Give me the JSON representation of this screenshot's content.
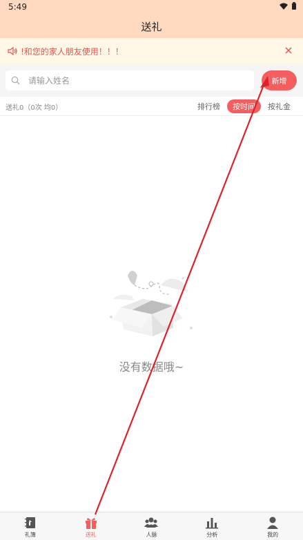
{
  "status_bar": {
    "time": "5:49"
  },
  "header": {
    "title": "送礼"
  },
  "notice": {
    "text": "!和您的家人朋友使用！！！"
  },
  "search": {
    "placeholder": "请输入姓名",
    "add_label": "新增"
  },
  "summary": {
    "text": "送礼0（0次 均0）"
  },
  "sort_tabs": [
    {
      "label": "排行榜",
      "active": false
    },
    {
      "label": "按时间",
      "active": true
    },
    {
      "label": "按礼金",
      "active": false
    }
  ],
  "empty_state": {
    "text": "没有数据哦~"
  },
  "bottom_nav": [
    {
      "label": "礼簿",
      "icon": "book-icon",
      "active": false
    },
    {
      "label": "送礼",
      "icon": "gift-icon",
      "active": true
    },
    {
      "label": "人脉",
      "icon": "people-icon",
      "active": false
    },
    {
      "label": "分析",
      "icon": "bar-chart-icon",
      "active": false
    },
    {
      "label": "我的",
      "icon": "person-icon",
      "active": false
    }
  ],
  "colors": {
    "accent": "#f45e5e",
    "header_bg": "#ffd9c0",
    "notice_bg": "#fff8e7",
    "annotation": "#e0202a"
  }
}
